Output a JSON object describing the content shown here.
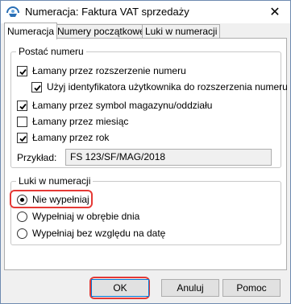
{
  "window": {
    "title": "Numeracja: Faktura VAT sprzedaży",
    "close_glyph": "✕"
  },
  "tabs": [
    {
      "label": "Numeracja",
      "active": true
    },
    {
      "label": "Numery początkowe",
      "active": false
    },
    {
      "label": "Luki w numeracji",
      "active": false
    }
  ],
  "format_group": {
    "label": "Postać numeru",
    "options": [
      {
        "label": "Łamany przez rozszerzenie numeru",
        "checked": true
      },
      {
        "label": "Użyj identyfikatora użytkownika do rozszerzenia numeru",
        "checked": true
      },
      {
        "label": "Łamany przez symbol magazynu/oddziału",
        "checked": true
      },
      {
        "label": "Łamany przez miesiąc",
        "checked": false
      },
      {
        "label": "Łamany przez rok",
        "checked": true
      }
    ],
    "example_label": "Przykład:",
    "example_value": "FS 123/SF/MAG/2018"
  },
  "gaps_group": {
    "label": "Luki w numeracji",
    "options": [
      {
        "label": "Nie wypełniaj",
        "selected": true
      },
      {
        "label": "Wypełniaj w obrębie dnia",
        "selected": false
      },
      {
        "label": "Wypełniaj bez względu na datę",
        "selected": false
      }
    ]
  },
  "buttons": {
    "ok": "OK",
    "cancel": "Anuluj",
    "help": "Pomoc"
  },
  "colors": {
    "highlight": "#e53935",
    "accent": "#0078d7"
  }
}
